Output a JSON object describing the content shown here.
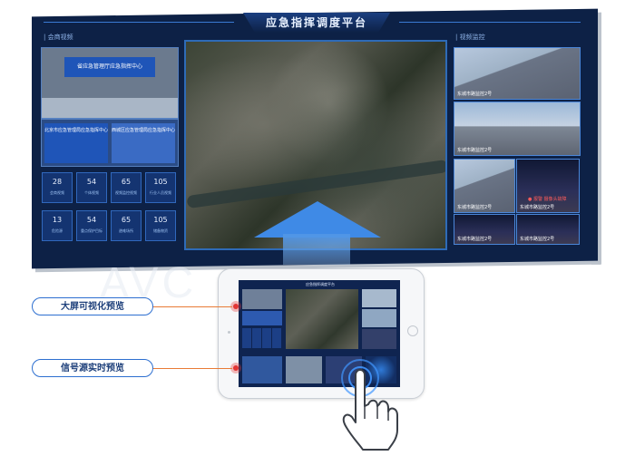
{
  "wall": {
    "title": "应急指挥调度平台",
    "left_panel_tag": "| 会商视频",
    "right_panel_tag": "| 视频监控",
    "meeting_top_banner": "省应急管理厅应急指挥中心",
    "meeting_bottom_left": "北京市应急管理局应急指挥中心",
    "meeting_bottom_right": "西城区应急管理局应急指挥中心",
    "stats": [
      {
        "value": "28",
        "label": "会商视频"
      },
      {
        "value": "54",
        "label": "个体视频"
      },
      {
        "value": "65",
        "label": "视频监控视频"
      },
      {
        "value": "105",
        "label": "行业人员视频"
      },
      {
        "value": "13",
        "label": "危险源"
      },
      {
        "value": "54",
        "label": "重点保护目标"
      },
      {
        "value": "65",
        "label": "避难场所"
      },
      {
        "value": "105",
        "label": "储备物资"
      }
    ],
    "cameras": [
      {
        "caption": "东城市路监控2号"
      },
      {
        "caption": "东城市路监控2号"
      },
      {
        "caption": "东城市路监控2号"
      },
      {
        "caption": "东城市路监控2号"
      },
      {
        "caption": "东城市路监控2号"
      },
      {
        "caption": "东城市路监控2号"
      }
    ],
    "alarm_text": "● 报警 摄像头故障"
  },
  "tablet": {
    "mini_title": "应急指挥调度平台"
  },
  "labels": {
    "big_screen_preview": "大屏可视化预览",
    "signal_preview": "信号源实时预览"
  },
  "watermark": "AVC"
}
